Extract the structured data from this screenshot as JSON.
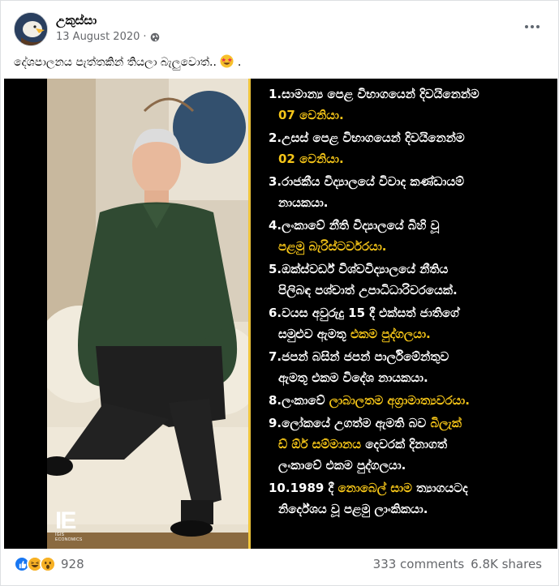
{
  "post": {
    "author": "උකුස්සා",
    "date": "13 August 2020",
    "separator": "·",
    "caption": "දේශපාලනය පැත්තකින් තියලා බැලුවොත්.. ",
    "caption_end": "."
  },
  "image": {
    "logo_text": "IE",
    "logo_sub": "IGIS ECONOMICS",
    "accent_color": "#f0c53a",
    "items": [
      {
        "lines": [
          {
            "text": "1.සාමාන්‍ය පෙළ විභාගයෙන් දිවයිනෙන්ම",
            "highlight": false
          },
          {
            "text": "07 වෙනියා.",
            "highlight": true,
            "indent": true
          }
        ]
      },
      {
        "lines": [
          {
            "text": "2.උසස් පෙළ විභාගයෙන් දිවයිනෙන්ම",
            "highlight": false
          },
          {
            "text": "02 වෙනියා.",
            "highlight": true,
            "indent": true
          }
        ]
      },
      {
        "lines": [
          {
            "text": "3.රාජකීය විද්‍යාලයේ විවාද කණ්ඩායම්",
            "highlight": false
          },
          {
            "text": "නායකයා.",
            "highlight": false,
            "indent": true
          }
        ]
      },
      {
        "lines": [
          {
            "text": "4.ලංකාවේ නීති විද්‍යාලයේ බිහි වූ",
            "highlight": false
          },
          {
            "text": "පළමු බැරිස්ටර්වරයා.",
            "highlight": true,
            "indent": true
          }
        ]
      },
      {
        "lines": [
          {
            "text": "5.ඔක්ස්වර්ඩ් විශ්වවිද්‍යාලයේ නීතිය",
            "highlight": false
          },
          {
            "text": "පිලිබඳ පශ්චාත් උපාධිධාරිවරයෙක්.",
            "highlight": false,
            "indent": true
          }
        ]
      },
      {
        "lines": [
          {
            "text": "6.වයස අවුරුදු 15 දී එක්සත් ජාතිගේ",
            "highlight": false
          },
          {
            "text": "සමුළුව ඇමතූ ",
            "highlight": false,
            "indent": true,
            "tail": "එකම පුද්ගලයා."
          }
        ]
      },
      {
        "lines": [
          {
            "text": "7.ජපන් බසින් ජපන් පාර්ලිමේන්තුව",
            "highlight": false
          },
          {
            "text": "ඇමතූ එකම විදේශ නායකයා.",
            "highlight": false,
            "indent": true
          }
        ]
      },
      {
        "lines": [
          {
            "text": "8.ලංකාවේ ",
            "highlight": false,
            "tail": "ලාබාලතම අග්‍රාමාත්‍යවරයා."
          }
        ]
      },
      {
        "lines": [
          {
            "text": "9.ලෝකයේ උගත්ම ඇමති බව ",
            "highlight": false,
            "tail": "බිලැක්"
          },
          {
            "text": "ඩ් ඕර් සම්මානය",
            "highlight": true,
            "indent": true,
            "tail_plain": " දෙවරක් දිනාගත්"
          },
          {
            "text": "ලංකාවේ එකම පුද්ගලයා.",
            "highlight": false,
            "indent": true
          }
        ]
      },
      {
        "lines": [
          {
            "text": "10.1989 දී ",
            "highlight": false,
            "tail": "නොබෙල් සාම",
            "tail_plain": " ත්‍යාගයටද"
          },
          {
            "text": "නිර්දේශය වූ පළමු ලාංකිකයා.",
            "highlight": false,
            "indent": true
          }
        ]
      }
    ]
  },
  "footer": {
    "reaction_icons": [
      "like-icon",
      "haha-icon",
      "wow-icon"
    ],
    "reaction_count": "928",
    "comments": "333 comments",
    "shares": "6.8K shares"
  }
}
